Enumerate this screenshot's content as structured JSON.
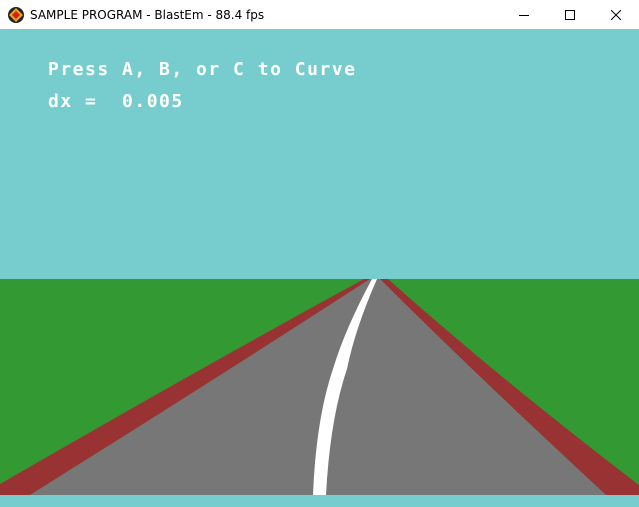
{
  "window": {
    "title": "SAMPLE PROGRAM - BlastEm - 88.4 fps"
  },
  "hud": {
    "line1": "Press A, B, or C to Curve",
    "line2": "dx =  0.005"
  },
  "icons": {
    "app": "blastem-app-icon",
    "minimize": "minimize-icon",
    "maximize": "maximize-icon",
    "close": "close-icon"
  },
  "colors": {
    "sky": "#77cdcd",
    "grass": "#339933",
    "road": "#777777",
    "rumble": "#993333",
    "center_line": "#ffffff"
  }
}
